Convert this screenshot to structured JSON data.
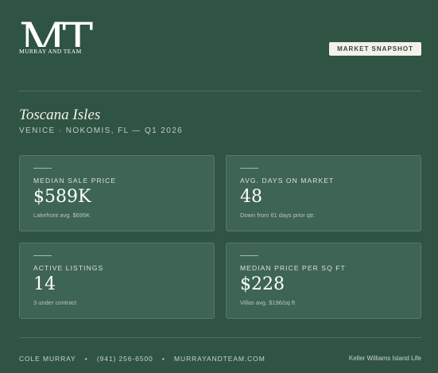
{
  "logo": {
    "monogram": "MT",
    "wordmark": "MURRAY AND TEAM"
  },
  "badge": "MARKET SNAPSHOT",
  "header": {
    "title": "Toscana Isles",
    "subtitle": "VENICE · NOKOMIS, FL — Q1 2026"
  },
  "stats": [
    {
      "label": "MEDIAN SALE PRICE",
      "value": "$589K",
      "note": "Lakefront avg. $695K"
    },
    {
      "label": "AVG. DAYS ON MARKET",
      "value": "48",
      "note": "Down from 61 days prior qtr."
    },
    {
      "label": "ACTIVE LISTINGS",
      "value": "14",
      "note": "3 under contract"
    },
    {
      "label": "MEDIAN PRICE PER SQ FT",
      "value": "$228",
      "note": "Villas avg. $196/sq ft"
    }
  ],
  "footer": {
    "name": "COLE MURRAY",
    "phone": "(941) 256-6500",
    "website": "MURRAYANDTEAM.COM",
    "separator": "•",
    "brokerage": "Keller Williams Island Life"
  },
  "colors": {
    "background": "#2f5443",
    "card": "#3e6454",
    "badge": "#f4f1ea"
  }
}
